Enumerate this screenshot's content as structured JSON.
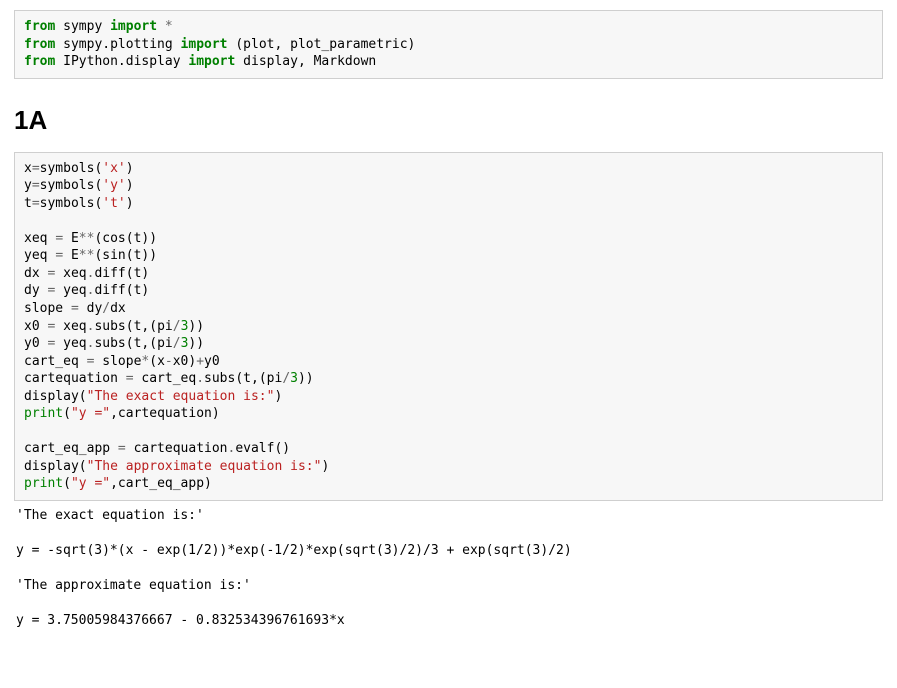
{
  "cell1": {
    "l1": {
      "kw1": "from",
      "mod": " sympy ",
      "kw2": "import",
      "op": " *"
    },
    "l2": {
      "kw1": "from",
      "mod": " sympy.plotting ",
      "kw2": "import",
      "rest": " (plot, plot_parametric)"
    },
    "l3": {
      "kw1": "from",
      "mod": " IPython.display ",
      "kw2": "import",
      "rest": " display, Markdown"
    }
  },
  "heading": "1A",
  "cell2": {
    "l1": {
      "a": "x",
      "op": "=",
      "b": "symbols(",
      "s": "'x'",
      "c": ")"
    },
    "l2": {
      "a": "y",
      "op": "=",
      "b": "symbols(",
      "s": "'y'",
      "c": ")"
    },
    "l3": {
      "a": "t",
      "op": "=",
      "b": "symbols(",
      "s": "'t'",
      "c": ")"
    },
    "l5": {
      "a": "xeq ",
      "op": "=",
      "b": " E",
      "op2": "**",
      "c": "(cos(t))"
    },
    "l6": {
      "a": "yeq ",
      "op": "=",
      "b": " E",
      "op2": "**",
      "c": "(sin(t))"
    },
    "l7": {
      "a": "dx ",
      "op": "=",
      "b": " xeq",
      "op2": ".",
      "c": "diff(t)"
    },
    "l8": {
      "a": "dy ",
      "op": "=",
      "b": " yeq",
      "op2": ".",
      "c": "diff(t)"
    },
    "l9": {
      "a": "slope ",
      "op": "=",
      "b": " dy",
      "op2": "/",
      "c": "dx"
    },
    "l10": {
      "a": "x0 ",
      "op": "=",
      "b": " xeq",
      "op2": ".",
      "c": "subs(t,(pi",
      "op3": "/",
      "n": "3",
      "d": "))"
    },
    "l11": {
      "a": "y0 ",
      "op": "=",
      "b": " yeq",
      "op2": ".",
      "c": "subs(t,(pi",
      "op3": "/",
      "n": "3",
      "d": "))"
    },
    "l12": {
      "a": "cart_eq ",
      "op": "=",
      "b": " slope",
      "op2": "*",
      "c": "(x",
      "op3": "-",
      "d": "x0)",
      "op4": "+",
      "e": "y0"
    },
    "l13": {
      "a": "cartequation ",
      "op": "=",
      "b": " cart_eq",
      "op2": ".",
      "c": "subs(t,(pi",
      "op3": "/",
      "n": "3",
      "d": "))"
    },
    "l14": {
      "a": "display(",
      "s": "\"The exact equation is:\"",
      "b": ")"
    },
    "l15": {
      "fn": "print",
      "a": "(",
      "s": "\"y =\"",
      "b": ",cartequation)"
    },
    "l17": {
      "a": "cart_eq_app ",
      "op": "=",
      "b": " cartequation",
      "op2": ".",
      "c": "evalf()"
    },
    "l18": {
      "a": "display(",
      "s": "\"The approximate equation is:\"",
      "b": ")"
    },
    "l19": {
      "fn": "print",
      "a": "(",
      "s": "\"y =\"",
      "b": ",cart_eq_app)"
    }
  },
  "output": "'The exact equation is:'\n\ny = -sqrt(3)*(x - exp(1/2))*exp(-1/2)*exp(sqrt(3)/2)/3 + exp(sqrt(3)/2)\n\n'The approximate equation is:'\n\ny = 3.75005984376667 - 0.832534396761693*x"
}
